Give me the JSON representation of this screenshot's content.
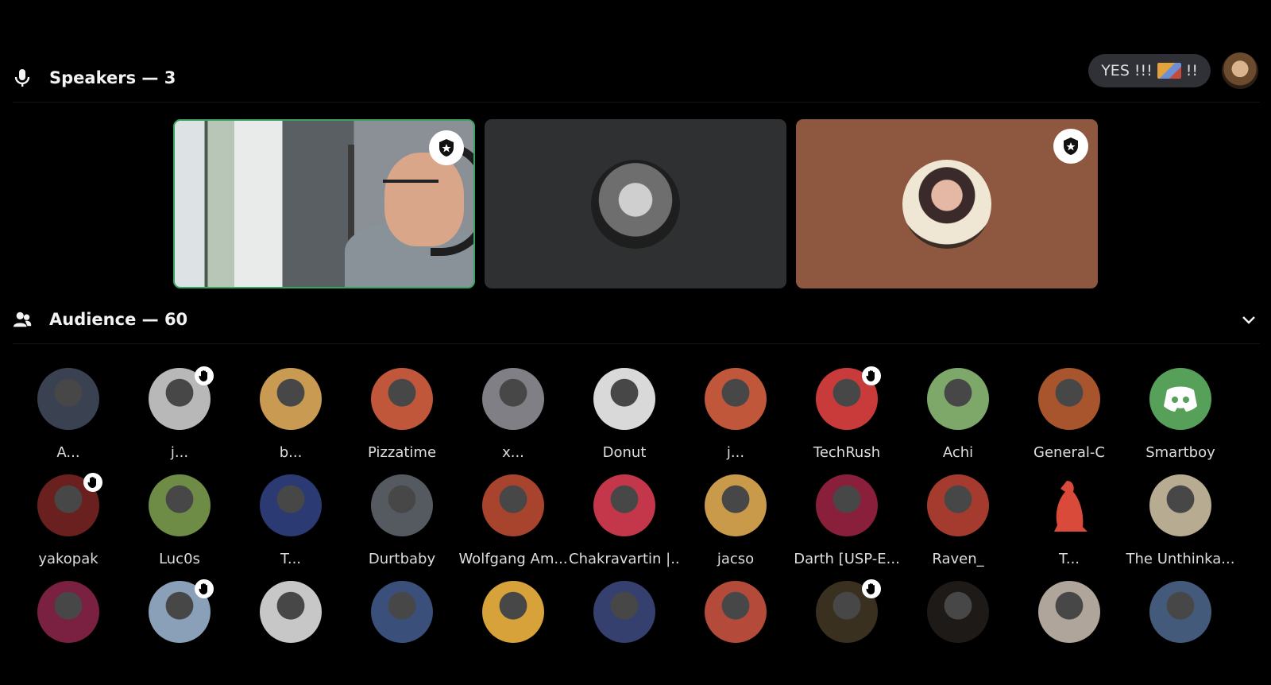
{
  "speakers": {
    "title": "Speakers — 3",
    "tiles": [
      {
        "kind": "video",
        "moderator": true
      },
      {
        "kind": "avatar",
        "moderator": false
      },
      {
        "kind": "avatar",
        "moderator": true
      }
    ]
  },
  "status": {
    "text_before": "YES !!!",
    "text_after": "!!"
  },
  "audience": {
    "title": "Audience — 60",
    "members": [
      {
        "name": "A...",
        "hand": false,
        "color": "#3a4150"
      },
      {
        "name": "j...",
        "hand": true,
        "color": "#b8b8b8"
      },
      {
        "name": "b...",
        "hand": false,
        "color": "#c89a52"
      },
      {
        "name": "Pizzatime",
        "hand": false,
        "color": "#c0563a"
      },
      {
        "name": "x...",
        "hand": false,
        "color": "#7f7f85"
      },
      {
        "name": "Donut",
        "hand": false,
        "color": "#d9d9d9"
      },
      {
        "name": "j...",
        "hand": false,
        "color": "#c0563a"
      },
      {
        "name": "TechRush",
        "hand": true,
        "color": "#c93a3a"
      },
      {
        "name": "Achi",
        "hand": false,
        "color": "#7ea86a"
      },
      {
        "name": "General-C",
        "hand": false,
        "color": "#a8542c"
      },
      {
        "name": "Smartboy",
        "hand": false,
        "color": "#57a05a",
        "discord": true
      },
      {
        "name": "yakopak",
        "hand": true,
        "color": "#6b2020"
      },
      {
        "name": "Luc0s",
        "hand": false,
        "color": "#6f8c47"
      },
      {
        "name": "T...",
        "hand": false,
        "color": "#2c3a73"
      },
      {
        "name": "Durtbaby",
        "hand": false,
        "color": "#555a60"
      },
      {
        "name": "Wolfgang Am...",
        "hand": false,
        "color": "#a8432e"
      },
      {
        "name": "Chakravartin |...",
        "hand": false,
        "color": "#c4374a"
      },
      {
        "name": "jacso",
        "hand": false,
        "color": "#c89a4a"
      },
      {
        "name": "Darth [USP-E...",
        "hand": false,
        "color": "#8a1f3c"
      },
      {
        "name": "Raven_",
        "hand": false,
        "color": "#a43b2e"
      },
      {
        "name": "T...",
        "hand": false,
        "color": "#000000",
        "penguin": true
      },
      {
        "name": "The Unthinka...",
        "hand": false,
        "color": "#b7ab92"
      },
      {
        "name": "",
        "hand": false,
        "color": "#7a2040"
      },
      {
        "name": "",
        "hand": true,
        "color": "#8aa0b8"
      },
      {
        "name": "",
        "hand": false,
        "color": "#c7c7c7"
      },
      {
        "name": "",
        "hand": false,
        "color": "#3a4f7a"
      },
      {
        "name": "",
        "hand": false,
        "color": "#d8a23a"
      },
      {
        "name": "",
        "hand": false,
        "color": "#35406e"
      },
      {
        "name": "",
        "hand": false,
        "color": "#b44a3a"
      },
      {
        "name": "",
        "hand": true,
        "color": "#3a3020"
      },
      {
        "name": "",
        "hand": false,
        "color": "#1e1a18"
      },
      {
        "name": "",
        "hand": false,
        "color": "#b0a59a"
      },
      {
        "name": "",
        "hand": false,
        "color": "#445a7a"
      }
    ]
  }
}
